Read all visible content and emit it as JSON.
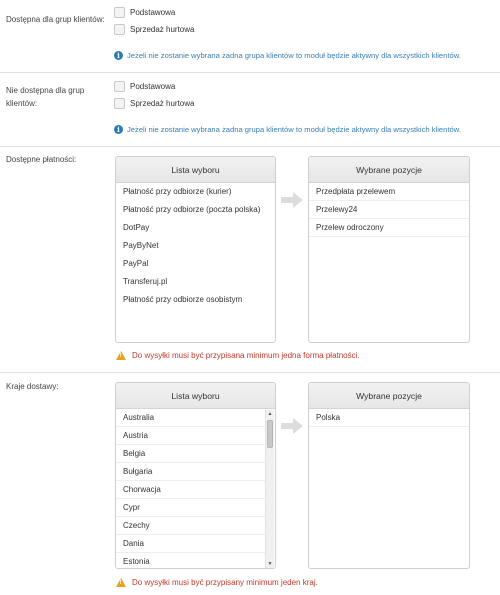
{
  "groups_available": {
    "label": "Dostępna dla grup klientów:",
    "options": [
      {
        "label": "Podstawowa"
      },
      {
        "label": "Sprzedaż hurtowa"
      }
    ],
    "info": "Jeżeli nie zostanie wybrana żadna grupa klientów to moduł będzie aktywny dla wszystkich klientów."
  },
  "groups_unavailable": {
    "label": "Nie dostępna dla grup klientów:",
    "options": [
      {
        "label": "Podstawowa"
      },
      {
        "label": "Sprzedaż hurtowa"
      }
    ],
    "info": "Jeżeli nie zostanie wybrana żadna grupa klientów to moduł będzie aktywny dla wszystkich klientów."
  },
  "payments": {
    "label": "Dostępne płatności:",
    "list_header": "Lista wyboru",
    "selected_header": "Wybrane pozycje",
    "list": [
      "Płatność przy odbiorze (kurier)",
      "Płatność przy odbiorze (poczta polska)",
      "DotPay",
      "PayByNet",
      "PayPal",
      "Transferuj.pl",
      "Płatność przy odbiorze osobistym"
    ],
    "selected": [
      "Przedpłata przelewem",
      "Przelewy24",
      "Przelew odroczony"
    ],
    "warning": "Do wysyłki musi być przypisana minimum jedna forma płatności."
  },
  "countries": {
    "label": "Kraje dostawy:",
    "list_header": "Lista wyboru",
    "selected_header": "Wybrane pozycje",
    "list": [
      "Australia",
      "Austria",
      "Belgia",
      "Bułgaria",
      "Chorwacja",
      "Cypr",
      "Czechy",
      "Dania",
      "Estonia"
    ],
    "selected": [
      "Polska"
    ],
    "warning": "Do wysyłki musi być przypisany minimum jeden kraj."
  },
  "icons": {
    "info": "info-icon",
    "warning": "warning-icon",
    "transfer": "arrow-right-icon"
  },
  "colors": {
    "info_text": "#3a7fb5",
    "warning_text": "#c0392b",
    "warning_icon": "#e8a317",
    "info_icon": "#2a7ab5"
  }
}
